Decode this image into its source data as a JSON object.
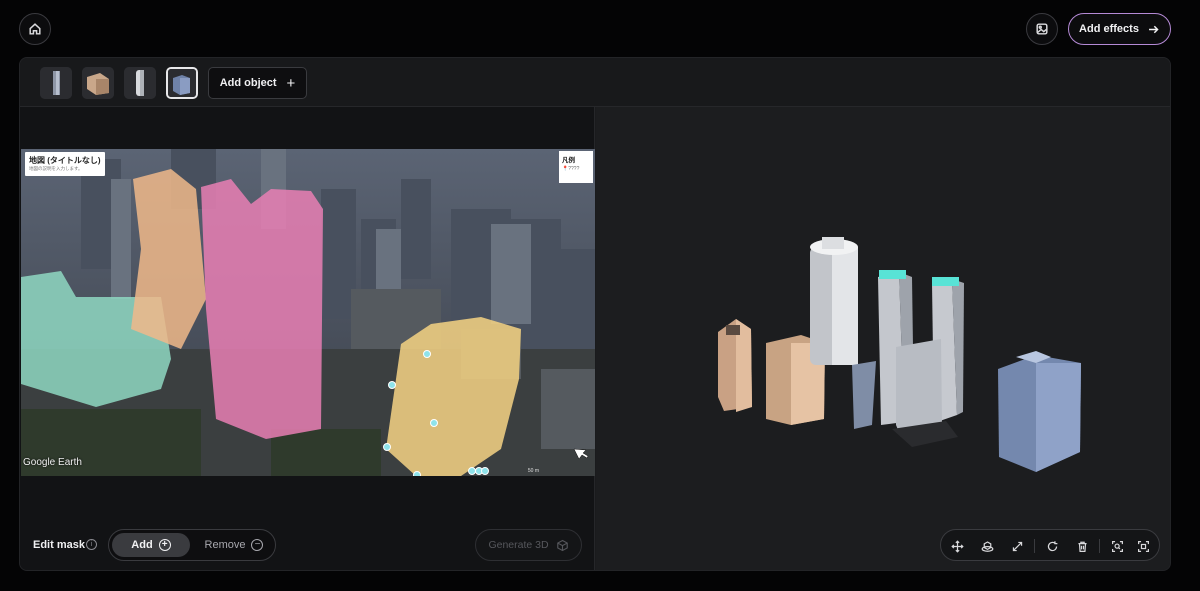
{
  "header": {
    "home_icon": "home-icon",
    "gallery_icon": "image-icon",
    "add_effects_label": "Add effects"
  },
  "thumbnails": [
    {
      "name": "object-thumbnail-1",
      "selected": false
    },
    {
      "name": "object-thumbnail-2",
      "selected": false
    },
    {
      "name": "object-thumbnail-3",
      "selected": false
    },
    {
      "name": "object-thumbnail-4",
      "selected": true
    }
  ],
  "toolbar": {
    "add_object_label": "Add object"
  },
  "photo": {
    "map_title": "地図 (タイトルなし)",
    "map_subtitle": "地図の説明を入力します。",
    "legend_title": "凡例",
    "legend_item": "????",
    "watermark": "Google Earth",
    "scale_label": "50 m"
  },
  "mask": {
    "edit_mask_label": "Edit mask",
    "add_label": "Add",
    "remove_label": "Remove",
    "generate_label": "Generate 3D"
  },
  "colors": {
    "accent_border": "#b58ad6",
    "mask_green": "#8fd8c2",
    "mask_orange": "#f0b98a",
    "mask_pink": "#e97fb4",
    "mask_yellow": "#f0cf82",
    "roof_cyan": "#58e3d6"
  }
}
